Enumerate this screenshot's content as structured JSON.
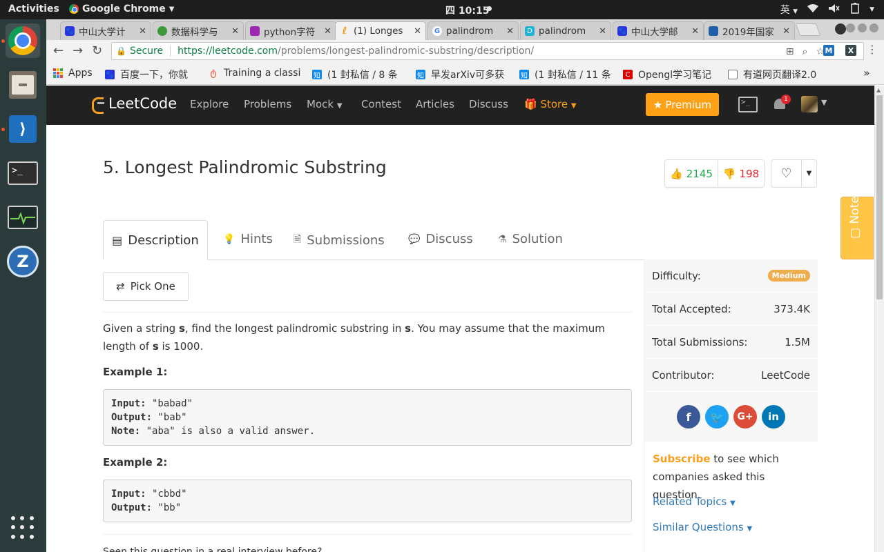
{
  "system": {
    "activities": "Activities",
    "app_name": "Google Chrome",
    "clock": "四 10:15",
    "ime": "英"
  },
  "tabs": [
    {
      "title": "中山大学计",
      "favicon": "baidu-paw",
      "color": "#2932e1"
    },
    {
      "title": "数据科学与",
      "favicon": "green-circle",
      "color": "#3a9a3a"
    },
    {
      "title": "python字符",
      "favicon": "book",
      "color": "#9c27b0"
    },
    {
      "title": "(1) Longes",
      "favicon": "leetcode",
      "color": "#f89f1b",
      "active": true
    },
    {
      "title": "palindrom",
      "favicon": "google-g",
      "color": "#4285f4"
    },
    {
      "title": "palindrom",
      "favicon": "d-logo",
      "color": "#1eb4d4"
    },
    {
      "title": "中山大学邮",
      "favicon": "baidu-paw",
      "color": "#2932e1"
    },
    {
      "title": "2019年国家",
      "favicon": "site",
      "color": "#1f5fa8"
    }
  ],
  "address_bar": {
    "secure_label": "Secure",
    "url_host": "https://leetcode.com",
    "url_path": "/problems/longest-palindromic-substring/description/"
  },
  "bookmarks": [
    {
      "label": "Apps",
      "icon": "apps-grid"
    },
    {
      "label": "百度一下，你就",
      "icon": "baidu-paw"
    },
    {
      "label": "Training a classi",
      "icon": "pytorch-flame"
    },
    {
      "label": "(1 封私信 / 8 条",
      "icon": "zhihu"
    },
    {
      "label": "早发arXiv可多获",
      "icon": "zhihu"
    },
    {
      "label": "(1 封私信 / 11 条",
      "icon": "zhihu"
    },
    {
      "label": "Opengl学习笔记",
      "icon": "csdn"
    },
    {
      "label": "有道网页翻译2.0",
      "icon": "page"
    }
  ],
  "bookmarks_overflow": "»",
  "lc_nav": {
    "logo": "LeetCode",
    "links": [
      "Explore",
      "Problems",
      "Mock",
      "Contest",
      "Articles",
      "Discuss"
    ],
    "store": "Store",
    "premium": "Premium",
    "notifications": "1"
  },
  "problem": {
    "title": "5. Longest Palindromic Substring",
    "likes": "2145",
    "dislikes": "198"
  },
  "page_tabs": [
    "Description",
    "Hints",
    "Submissions",
    "Discuss",
    "Solution"
  ],
  "pick_one": "Pick One",
  "description": {
    "part1": "Given a string ",
    "s1": "s",
    "part2": ", find the longest palindromic substring in ",
    "s2": "s",
    "part3": ". You may assume that the maximum length of ",
    "s3": "s",
    "part4": " is 1000."
  },
  "examples": [
    {
      "title": "Example 1:",
      "input_label": "Input:",
      "input": " \"babad\"",
      "output_label": "Output:",
      "output": " \"bab\"",
      "note_label": "Note:",
      "note": " \"aba\" is also a valid answer."
    },
    {
      "title": "Example 2:",
      "input_label": "Input:",
      "input": " \"cbbd\"",
      "output_label": "Output:",
      "output": " \"bb\""
    }
  ],
  "bottom_peek": "Seen this question in a real interview before?",
  "sidebar": {
    "difficulty_label": "Difficulty:",
    "difficulty": "Medium",
    "accepted_label": "Total Accepted:",
    "accepted": "373.4K",
    "submissions_label": "Total Submissions:",
    "submissions": "1.5M",
    "contributor_label": "Contributor:",
    "contributor": "LeetCode",
    "subscribe_link": "Subscribe",
    "subscribe_text": " to see which companies asked this question.",
    "related_topics": "Related Topics",
    "similar_questions": "Similar Questions"
  },
  "notes_tab": "Notes",
  "colors": {
    "accent_orange": "#ffa116",
    "like_green": "#1ba94c",
    "dislike_red": "#e0262c",
    "link_blue": "#337ab7",
    "medium_badge": "#f0ad4e"
  }
}
